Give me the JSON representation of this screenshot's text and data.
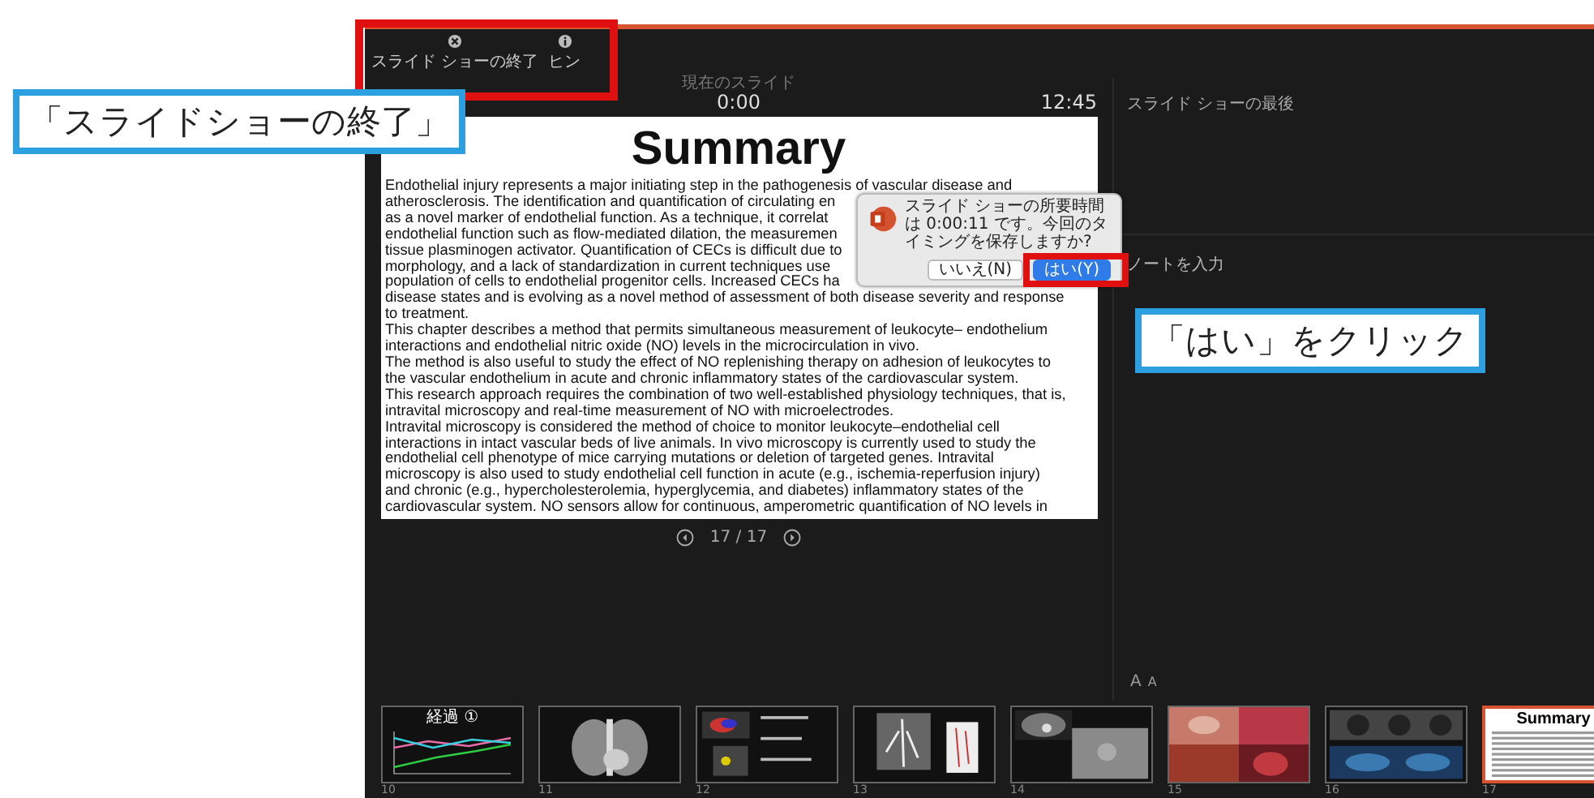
{
  "toolbar": {
    "items": [
      {
        "kind": "end",
        "label": "スライド ショーの終了"
      },
      {
        "kind": "hint",
        "label": "ヒン"
      }
    ]
  },
  "header": {
    "caption": "現在のスライド",
    "elapsed": "0:00",
    "clock": "12:45"
  },
  "slide": {
    "title": "Summary",
    "lines_1": [
      "Endothelial injury represents a major initiating step in the pathogenesis of vascular disease and",
      "atherosclerosis. The identification and quantification of circulating en",
      "as a novel marker of endothelial function. As a technique, it correlat",
      "endothelial function such as flow-mediated dilation, the measuremen",
      "tissue plasminogen activator. Quantification of CECs is difficult due to",
      "morphology, and a lack of standardization in current techniques use",
      "population of cells to endothelial progenitor cells. Increased CECs ha",
      "disease states and is evolving as a novel method of assessment of both disease severity and response",
      "to treatment."
    ],
    "lines_2": [
      "This chapter describes a method that permits simultaneous measurement of leukocyte– endothelium",
      "interactions and endothelial nitric oxide (NO) levels in the microcirculation in vivo.",
      "The method is also useful to study the effect of NO replenishing therapy on adhesion of leukocytes to",
      "the vascular endothelium in acute and chronic inflammatory states of the cardiovascular system.",
      "This research approach requires the combination of two well-established physiology techniques, that is,",
      "intravital microscopy and real-time measurement of NO with microelectrodes.",
      "Intravital microscopy is considered the method of choice to monitor leukocyte–endothelial cell",
      "interactions in intact vascular beds of live animals. In vivo microscopy is currently used to study the",
      "endothelial cell phenotype of mice carrying mutations or deletion of targeted genes. Intravital",
      "microscopy is also used to study endothelial cell function in acute (e.g., ischemia-reperfusion injury)",
      "and chronic (e.g., hypercholesterolemia, hyperglycemia, and diabetes) inflammatory states of the",
      "cardiovascular system. NO sensors allow for continuous, amperometric quantification of NO levels in"
    ]
  },
  "slide_nav": {
    "counter": "17 / 17"
  },
  "next_slide": {
    "text": "スライド ショーの最後"
  },
  "notes": {
    "placeholder": "ノートを入力"
  },
  "font_buttons": [
    {
      "kind": "larger",
      "label": "A"
    },
    {
      "kind": "smaller",
      "label": "A"
    }
  ],
  "thumbnails": [
    {
      "number": "10",
      "kind": "chart",
      "title": "経過 ①",
      "selected": false
    },
    {
      "number": "11",
      "kind": "picture",
      "selected": false
    },
    {
      "number": "12",
      "kind": "picture",
      "selected": false
    },
    {
      "number": "13",
      "kind": "picture",
      "selected": false
    },
    {
      "number": "14",
      "kind": "picture",
      "selected": false
    },
    {
      "number": "15",
      "kind": "picture",
      "selected": false
    },
    {
      "number": "16",
      "kind": "picture",
      "selected": false
    },
    {
      "number": "17",
      "kind": "text",
      "title": "Summary",
      "selected": true
    }
  ],
  "dialog": {
    "message": "スライド ショーの所要時間は 0:00:11 です。今回のタイミングを保存しますか?",
    "buttons": [
      {
        "label": "いいえ(N)",
        "default": false
      },
      {
        "label": "はい(Y)",
        "default": true
      }
    ]
  },
  "annotations": [
    {
      "kind": "callout",
      "text": "「スライドショーの終了」"
    },
    {
      "kind": "callout",
      "text": "「はい」をクリック"
    }
  ]
}
